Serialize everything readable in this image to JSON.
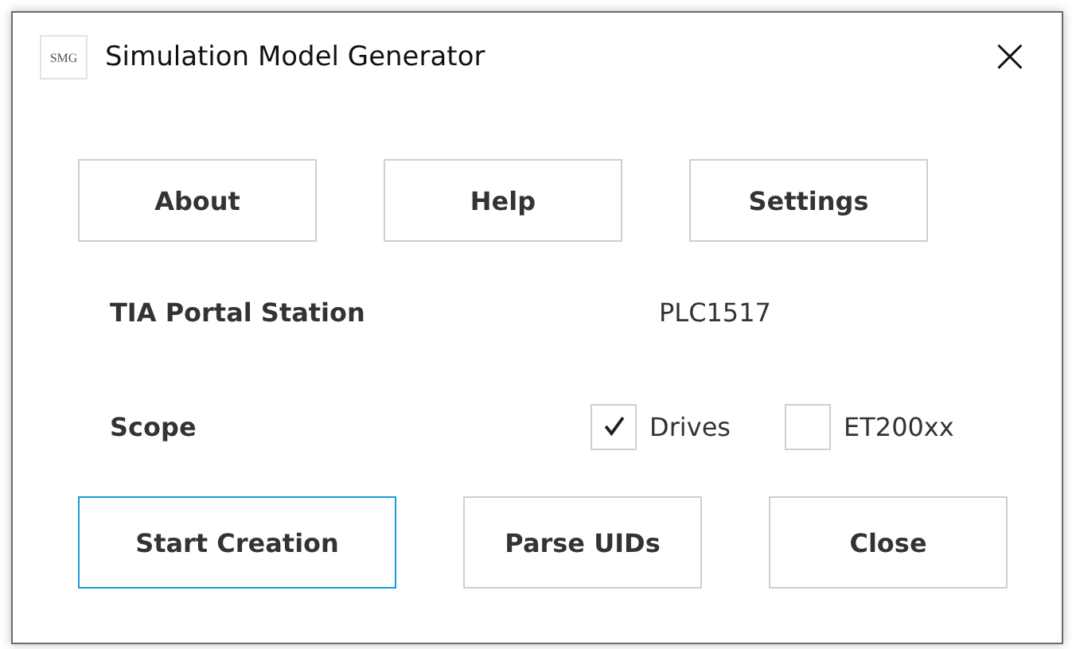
{
  "window": {
    "icon_text": "SMG",
    "title": "Simulation Model Generator",
    "close": "×"
  },
  "top_buttons": [
    {
      "label": "About",
      "focused": false
    },
    {
      "label": "Help",
      "focused": false
    },
    {
      "label": "Settings",
      "focused": false
    }
  ],
  "station": {
    "label": "TIA Portal Station",
    "value": "PLC1517"
  },
  "scope": {
    "label": "Scope",
    "options": [
      {
        "label": "Drives",
        "checked": true
      },
      {
        "label": "ET200xx",
        "checked": false
      }
    ]
  },
  "bottom_buttons": [
    {
      "label": "Start Creation",
      "focused": true
    },
    {
      "label": "Parse UIDs",
      "focused": false
    },
    {
      "label": "Close",
      "focused": false
    }
  ]
}
